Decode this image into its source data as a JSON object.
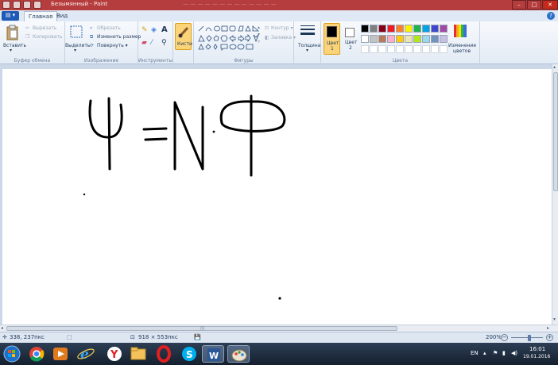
{
  "window": {
    "title": "Безымянный - Paint",
    "title_faded": "— — — — — — — — — — — — —",
    "min_label": "–",
    "max_label": "□",
    "close_label": "✕"
  },
  "tabs": {
    "file": "▤ ▾",
    "home": "Главная",
    "view": "Вид",
    "help": "?"
  },
  "ribbon": {
    "clipboard": {
      "paste": "Вставить",
      "cut": "Вырезать",
      "copy": "Копировать",
      "group": "Буфер обмена"
    },
    "image": {
      "select": "Выделить",
      "crop": "Обрезать",
      "resize": "Изменить размер",
      "rotate": "Повернуть ▾",
      "group": "Изображение"
    },
    "tools": {
      "group": "Инструменты"
    },
    "brushes": {
      "label": "Кисти"
    },
    "shapes": {
      "outline": "Контур ▾",
      "fill": "Заливка ▾",
      "group": "Фигуры"
    },
    "size": {
      "label": "Толщина"
    },
    "color1": {
      "line1": "Цвет",
      "line2": "1"
    },
    "color2": {
      "line1": "Цвет",
      "line2": "2"
    },
    "edit_colors": {
      "line1": "Изменение",
      "line2": "цветов"
    },
    "colors_group": "Цвета",
    "palette_row1": [
      "#000000",
      "#7f7f7f",
      "#880015",
      "#ed1c24",
      "#ff7f27",
      "#fff200",
      "#22b14c",
      "#00a2e8",
      "#3f48cc",
      "#a349a4"
    ],
    "palette_row2": [
      "#ffffff",
      "#c3c3c3",
      "#b97a57",
      "#ffaec9",
      "#ffc90e",
      "#efe4b0",
      "#b5e61d",
      "#99d9ea",
      "#7092be",
      "#c8bfe7"
    ],
    "primary_color": "#000000",
    "secondary_color": "#ffffff"
  },
  "status": {
    "cursor_pos": "338, 237пкс",
    "image_size": "918 × 553пкс",
    "zoom": "200%",
    "zoom_out": "−",
    "zoom_in": "+"
  },
  "taskbar": {
    "lang": "EN",
    "time": "16:01",
    "date": "19.01.2016"
  }
}
